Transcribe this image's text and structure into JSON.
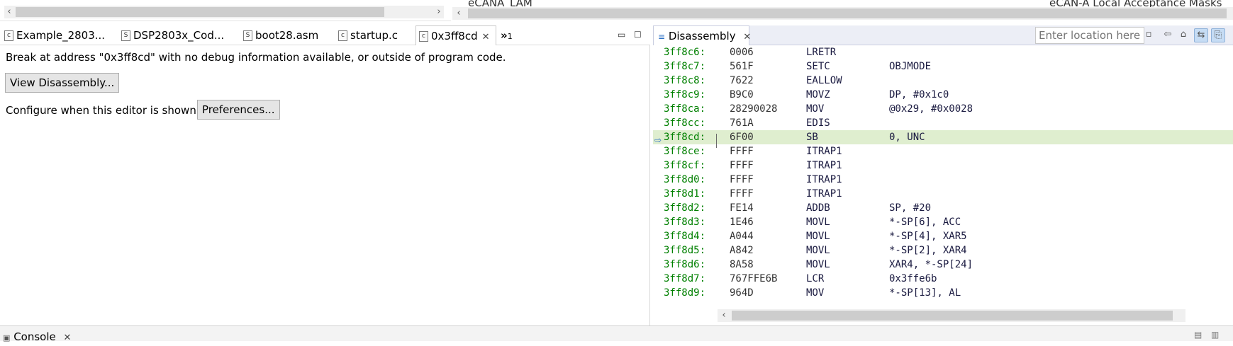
{
  "top": {
    "right_cut_text_left": "eCANA_LAM",
    "right_cut_text_right": "eCAN-A Local Acceptance Masks"
  },
  "editor_tabs": [
    {
      "label": "Example_2803...",
      "icon": "c-file-icon",
      "active": false
    },
    {
      "label": "DSP2803x_Cod...",
      "icon": "s-file-icon",
      "active": false
    },
    {
      "label": "boot28.asm",
      "icon": "s-file-icon",
      "active": false
    },
    {
      "label": "startup.c",
      "icon": "c-file-icon",
      "active": false
    },
    {
      "label": "0x3ff8cd",
      "icon": "c-file-icon",
      "active": true
    }
  ],
  "editor_overflow": "»",
  "editor_overflow_count": "1",
  "editor": {
    "message": "Break at address \"0x3ff8cd\" with no debug information available, or outside of program code.",
    "view_disassembly_button": "View Disassembly...",
    "configure_text": "Configure when this editor is shown",
    "preferences_button": "Preferences..."
  },
  "disassembly": {
    "tab_label": "Disassembly",
    "location_placeholder": "Enter location here",
    "current_address": "3ff8cd:",
    "rows": [
      {
        "addr": "3ff8c6:",
        "op": "0006",
        "mn": "LRETR",
        "arg": ""
      },
      {
        "addr": "3ff8c7:",
        "op": "561F",
        "mn": "SETC",
        "arg": "OBJMODE"
      },
      {
        "addr": "3ff8c8:",
        "op": "7622",
        "mn": "EALLOW",
        "arg": ""
      },
      {
        "addr": "3ff8c9:",
        "op": "B9C0",
        "mn": "MOVZ",
        "arg": "DP, #0x1c0"
      },
      {
        "addr": "3ff8ca:",
        "op": "28290028",
        "mn": "MOV",
        "arg": "@0x29, #0x0028"
      },
      {
        "addr": "3ff8cc:",
        "op": "761A",
        "mn": "EDIS",
        "arg": ""
      },
      {
        "addr": "3ff8cd:",
        "op": "6F00",
        "mn": "SB",
        "arg": "0, UNC"
      },
      {
        "addr": "3ff8ce:",
        "op": "FFFF",
        "mn": "ITRAP1",
        "arg": ""
      },
      {
        "addr": "3ff8cf:",
        "op": "FFFF",
        "mn": "ITRAP1",
        "arg": ""
      },
      {
        "addr": "3ff8d0:",
        "op": "FFFF",
        "mn": "ITRAP1",
        "arg": ""
      },
      {
        "addr": "3ff8d1:",
        "op": "FFFF",
        "mn": "ITRAP1",
        "arg": ""
      },
      {
        "addr": "3ff8d2:",
        "op": "FE14",
        "mn": "ADDB",
        "arg": "SP, #20"
      },
      {
        "addr": "3ff8d3:",
        "op": "1E46",
        "mn": "MOVL",
        "arg": "*-SP[6], ACC"
      },
      {
        "addr": "3ff8d4:",
        "op": "A044",
        "mn": "MOVL",
        "arg": "*-SP[4], XAR5"
      },
      {
        "addr": "3ff8d5:",
        "op": "A842",
        "mn": "MOVL",
        "arg": "*-SP[2], XAR4"
      },
      {
        "addr": "3ff8d6:",
        "op": "8A58",
        "mn": "MOVL",
        "arg": "XAR4, *-SP[24]"
      },
      {
        "addr": "3ff8d7:",
        "op": "767FFE6B",
        "mn": "LCR",
        "arg": "0x3ffe6b"
      },
      {
        "addr": "3ff8d9:",
        "op": "964D",
        "mn": "MOV",
        "arg": "*-SP[13], AL"
      }
    ]
  },
  "console": {
    "label": "Console"
  },
  "colors": {
    "address": "#008000",
    "current_line": "#dfeecf",
    "tab_strip": "#eceef6"
  }
}
